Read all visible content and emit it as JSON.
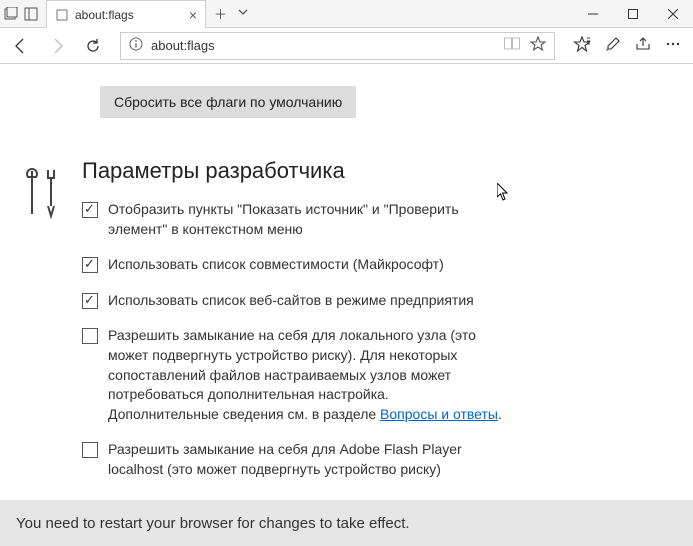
{
  "tab": {
    "title": "about:flags"
  },
  "addressbar": {
    "url": "about:flags"
  },
  "content": {
    "reset_button": "Сбросить все флаги по умолчанию",
    "section_title": "Параметры разработчика",
    "options": [
      {
        "checked": true,
        "text": "Отобразить пункты \"Показать источник\" и \"Проверить элемент\" в контекстном меню"
      },
      {
        "checked": true,
        "text": "Использовать список совместимости (Майкрософт)"
      },
      {
        "checked": true,
        "text": "Использовать список веб-сайтов в режиме предприятия"
      },
      {
        "checked": false,
        "text": "Разрешить замыкание на себя для локального узла (это может подвергнуть устройство риску). Для некоторых сопоставлений файлов настраиваемых узлов может потребоваться дополнительная настройка. Дополнительные сведения см. в разделе ",
        "link": "Вопросы и ответы",
        "suffix": "."
      },
      {
        "checked": false,
        "text": "Разрешить замыкание на себя для Adobe Flash Player localhost (это может подвергнуть устройство риску)"
      }
    ]
  },
  "restart_message": "You need to restart your browser for changes to take effect."
}
